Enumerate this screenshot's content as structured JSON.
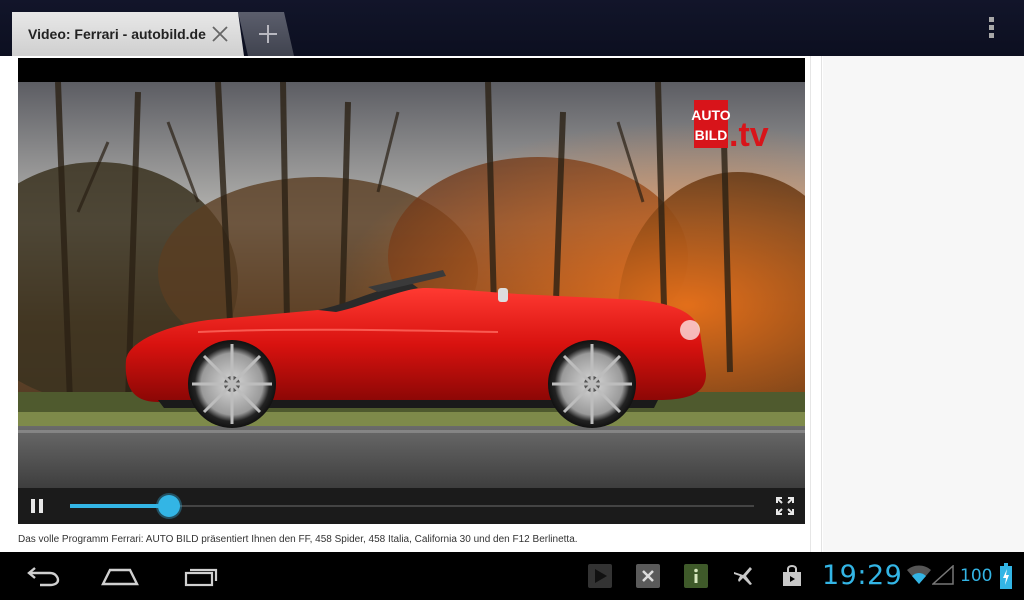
{
  "browser": {
    "tab_title": "Video: Ferrari - autobild.de"
  },
  "video": {
    "logo_line1": "AUTO",
    "logo_line2": "BILD",
    "logo_suffix": ".tv",
    "progress_fraction": 0.145,
    "caption": "Das volle Programm Ferrari: AUTO BILD präsentiert Ihnen den FF, 458 Spider, 458 Italia, California 30 und den F12 Berlinetta."
  },
  "status_bar": {
    "time": "19:29",
    "battery_level": "100"
  },
  "colors": {
    "accent": "#33b5e5",
    "logo_red": "#d8141a"
  },
  "icons": {
    "back": "back-icon",
    "home": "home-icon",
    "recents": "recent-apps-icon",
    "overflow": "overflow-menu-icon"
  }
}
